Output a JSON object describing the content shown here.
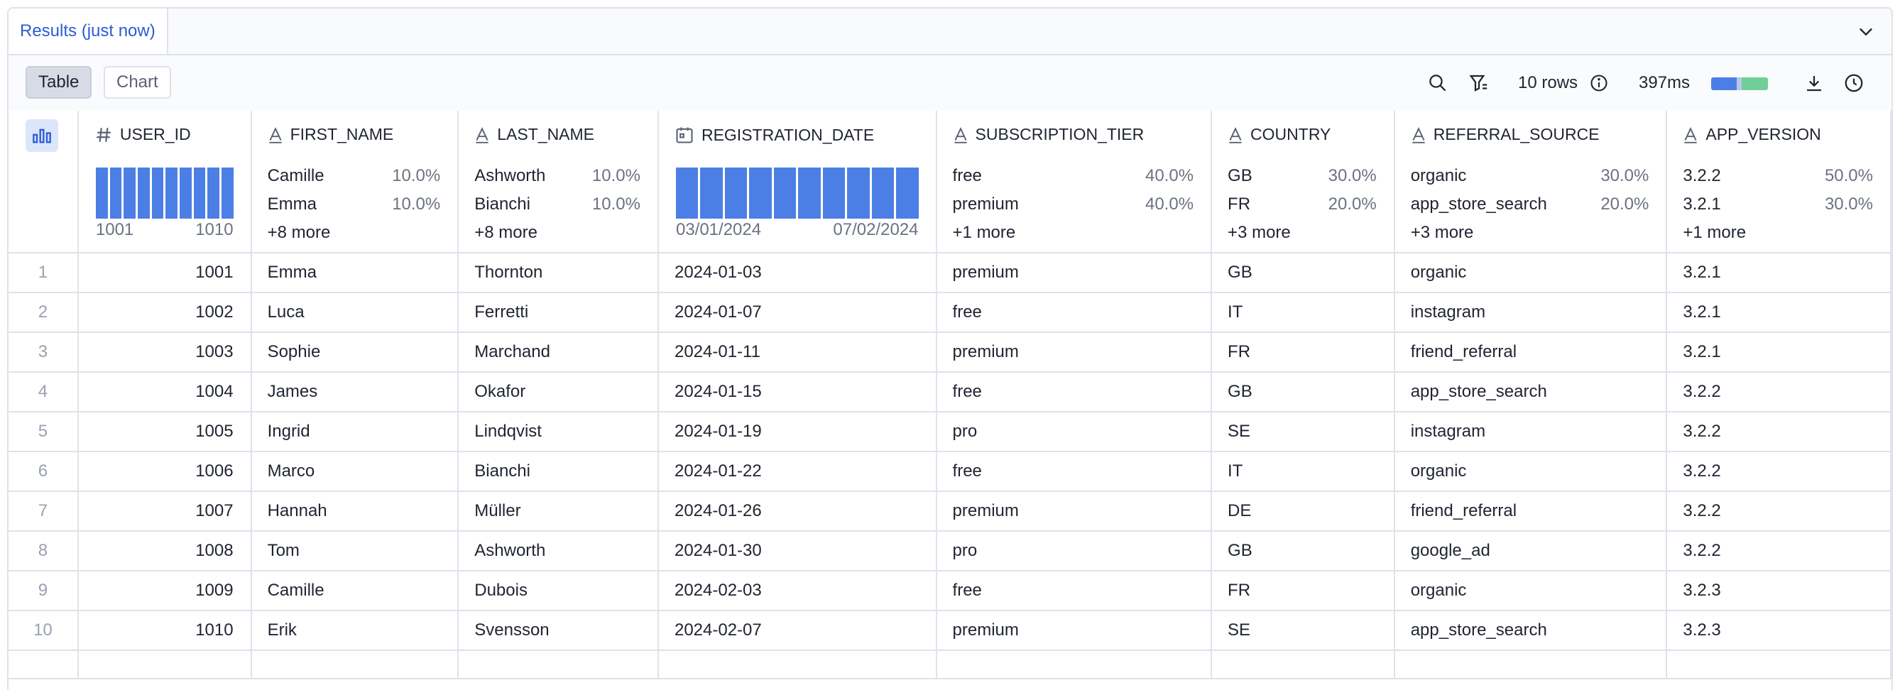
{
  "results_tab": "Results (just now)",
  "toolbar": {
    "table_label": "Table",
    "chart_label": "Chart",
    "rows_label": "10 rows",
    "time_label": "397ms"
  },
  "colors": {
    "accent": "#2c5bd6",
    "histogram": "#4c7fe6",
    "progress_green": "#6fcf97"
  },
  "columns": [
    {
      "name": "USER_ID",
      "icon": "hash-icon",
      "type": "histogram",
      "range_min": "1001",
      "range_max": "1010",
      "bins": 10
    },
    {
      "name": "FIRST_NAME",
      "icon": "text-type-icon",
      "type": "values",
      "top": [
        {
          "value": "Camille",
          "pct": "10.0%"
        },
        {
          "value": "Emma",
          "pct": "10.0%"
        }
      ],
      "more": "+8 more"
    },
    {
      "name": "LAST_NAME",
      "icon": "text-type-icon",
      "type": "values",
      "top": [
        {
          "value": "Ashworth",
          "pct": "10.0%"
        },
        {
          "value": "Bianchi",
          "pct": "10.0%"
        }
      ],
      "more": "+8 more"
    },
    {
      "name": "REGISTRATION_DATE",
      "icon": "calendar-icon",
      "type": "histogram",
      "range_min": "03/01/2024",
      "range_max": "07/02/2024",
      "bins": 10
    },
    {
      "name": "SUBSCRIPTION_TIER",
      "icon": "text-type-icon",
      "type": "values",
      "top": [
        {
          "value": "free",
          "pct": "40.0%"
        },
        {
          "value": "premium",
          "pct": "40.0%"
        }
      ],
      "more": "+1 more"
    },
    {
      "name": "COUNTRY",
      "icon": "text-type-icon",
      "type": "values",
      "top": [
        {
          "value": "GB",
          "pct": "30.0%"
        },
        {
          "value": "FR",
          "pct": "20.0%"
        }
      ],
      "more": "+3 more"
    },
    {
      "name": "REFERRAL_SOURCE",
      "icon": "text-type-icon",
      "type": "values",
      "top": [
        {
          "value": "organic",
          "pct": "30.0%"
        },
        {
          "value": "app_store_search",
          "pct": "20.0%"
        }
      ],
      "more": "+3 more"
    },
    {
      "name": "APP_VERSION",
      "icon": "text-type-icon",
      "type": "values",
      "top": [
        {
          "value": "3.2.2",
          "pct": "50.0%"
        },
        {
          "value": "3.2.1",
          "pct": "30.0%"
        }
      ],
      "more": "+1 more"
    }
  ],
  "rows": [
    [
      "1",
      "1001",
      "Emma",
      "Thornton",
      "2024-01-03",
      "premium",
      "GB",
      "organic",
      "3.2.1"
    ],
    [
      "2",
      "1002",
      "Luca",
      "Ferretti",
      "2024-01-07",
      "free",
      "IT",
      "instagram",
      "3.2.1"
    ],
    [
      "3",
      "1003",
      "Sophie",
      "Marchand",
      "2024-01-11",
      "premium",
      "FR",
      "friend_referral",
      "3.2.1"
    ],
    [
      "4",
      "1004",
      "James",
      "Okafor",
      "2024-01-15",
      "free",
      "GB",
      "app_store_search",
      "3.2.2"
    ],
    [
      "5",
      "1005",
      "Ingrid",
      "Lindqvist",
      "2024-01-19",
      "pro",
      "SE",
      "instagram",
      "3.2.2"
    ],
    [
      "6",
      "1006",
      "Marco",
      "Bianchi",
      "2024-01-22",
      "free",
      "IT",
      "organic",
      "3.2.2"
    ],
    [
      "7",
      "1007",
      "Hannah",
      "Müller",
      "2024-01-26",
      "premium",
      "DE",
      "friend_referral",
      "3.2.2"
    ],
    [
      "8",
      "1008",
      "Tom",
      "Ashworth",
      "2024-01-30",
      "pro",
      "GB",
      "google_ad",
      "3.2.2"
    ],
    [
      "9",
      "1009",
      "Camille",
      "Dubois",
      "2024-02-03",
      "free",
      "FR",
      "organic",
      "3.2.3"
    ],
    [
      "10",
      "1010",
      "Erik",
      "Svensson",
      "2024-02-07",
      "premium",
      "SE",
      "app_store_search",
      "3.2.3"
    ]
  ]
}
